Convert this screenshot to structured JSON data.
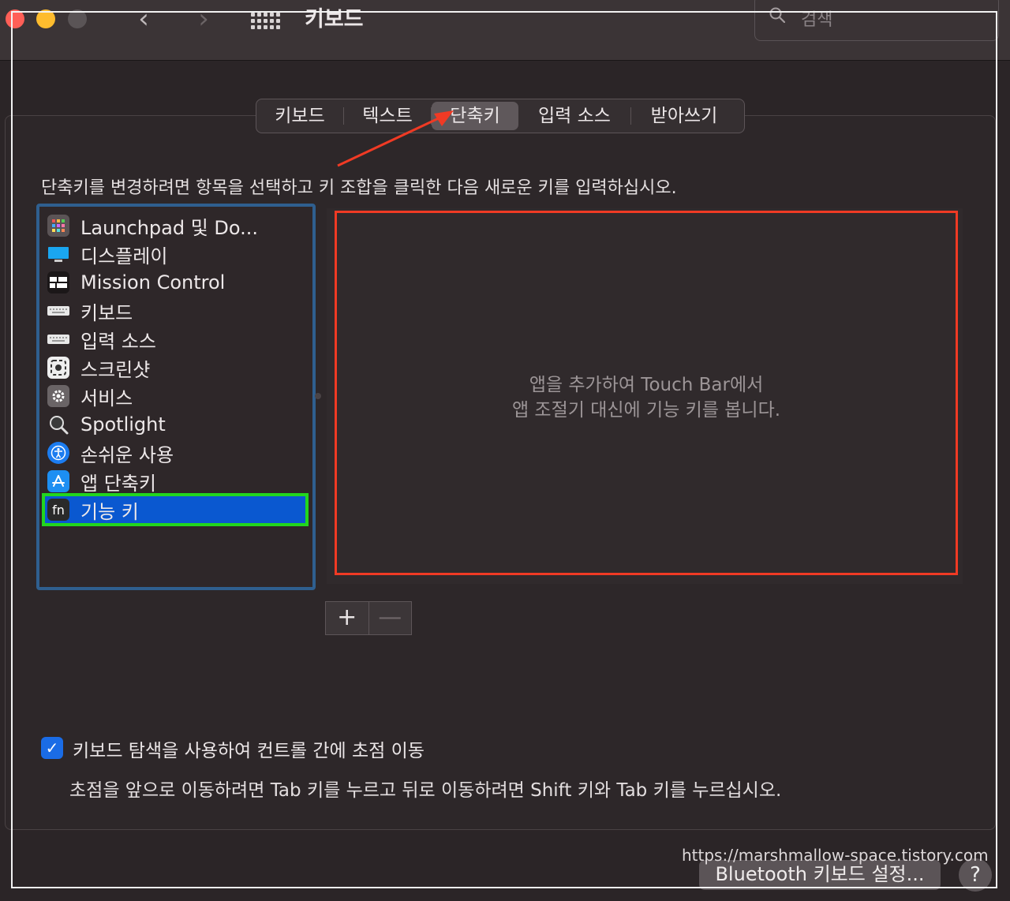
{
  "window": {
    "title": "키보드",
    "search_placeholder": "검색"
  },
  "tabs": [
    {
      "label": "키보드",
      "selected": false
    },
    {
      "label": "텍스트",
      "selected": false
    },
    {
      "label": "단축키",
      "selected": true
    },
    {
      "label": "입력 소스",
      "selected": false
    },
    {
      "label": "받아쓰기",
      "selected": false
    }
  ],
  "instruction": "단축키를 변경하려면 항목을 선택하고 키 조합을 클릭한 다음 새로운 키를 입력하십시오.",
  "sidebar": {
    "items": [
      {
        "label": "Launchpad 및 Do...",
        "icon": "launchpad-icon"
      },
      {
        "label": "디스플레이",
        "icon": "display-icon"
      },
      {
        "label": "Mission Control",
        "icon": "mission-control-icon"
      },
      {
        "label": "키보드",
        "icon": "keyboard-icon"
      },
      {
        "label": "입력 소스",
        "icon": "keyboard-icon"
      },
      {
        "label": "스크린샷",
        "icon": "screenshot-icon"
      },
      {
        "label": "서비스",
        "icon": "gear-icon"
      },
      {
        "label": "Spotlight",
        "icon": "spotlight-icon"
      },
      {
        "label": "손쉬운 사용",
        "icon": "accessibility-icon"
      },
      {
        "label": "앱 단축키",
        "icon": "app-store-icon"
      },
      {
        "label": "기능 키",
        "icon": "fn-icon",
        "icon_text": "fn",
        "selected": true
      }
    ]
  },
  "pane": {
    "line1": "앱을 추가하여 Touch Bar에서",
    "line2": "앱 조절기 대신에 기능 키를 봅니다."
  },
  "buttons": {
    "add": "+",
    "remove": "—",
    "bluetooth": "Bluetooth 키보드 설정...",
    "help": "?"
  },
  "keyboard_nav": {
    "checked": true,
    "label": "키보드 탐색을 사용하여 컨트롤 간에 초점 이동",
    "hint": "초점을 앞으로 이동하려면 Tab 키를 누르고 뒤로 이동하려면 Shift 키와 Tab 키를 누르십시오."
  },
  "watermark": "https://marshmallow-space.tistory.com",
  "colors": {
    "selection": "#0a58d0",
    "highlight_green": "#22d61e",
    "highlight_red": "#f03a24",
    "highlight_blue": "#2f5f8f",
    "checkbox": "#1a6ce6"
  }
}
